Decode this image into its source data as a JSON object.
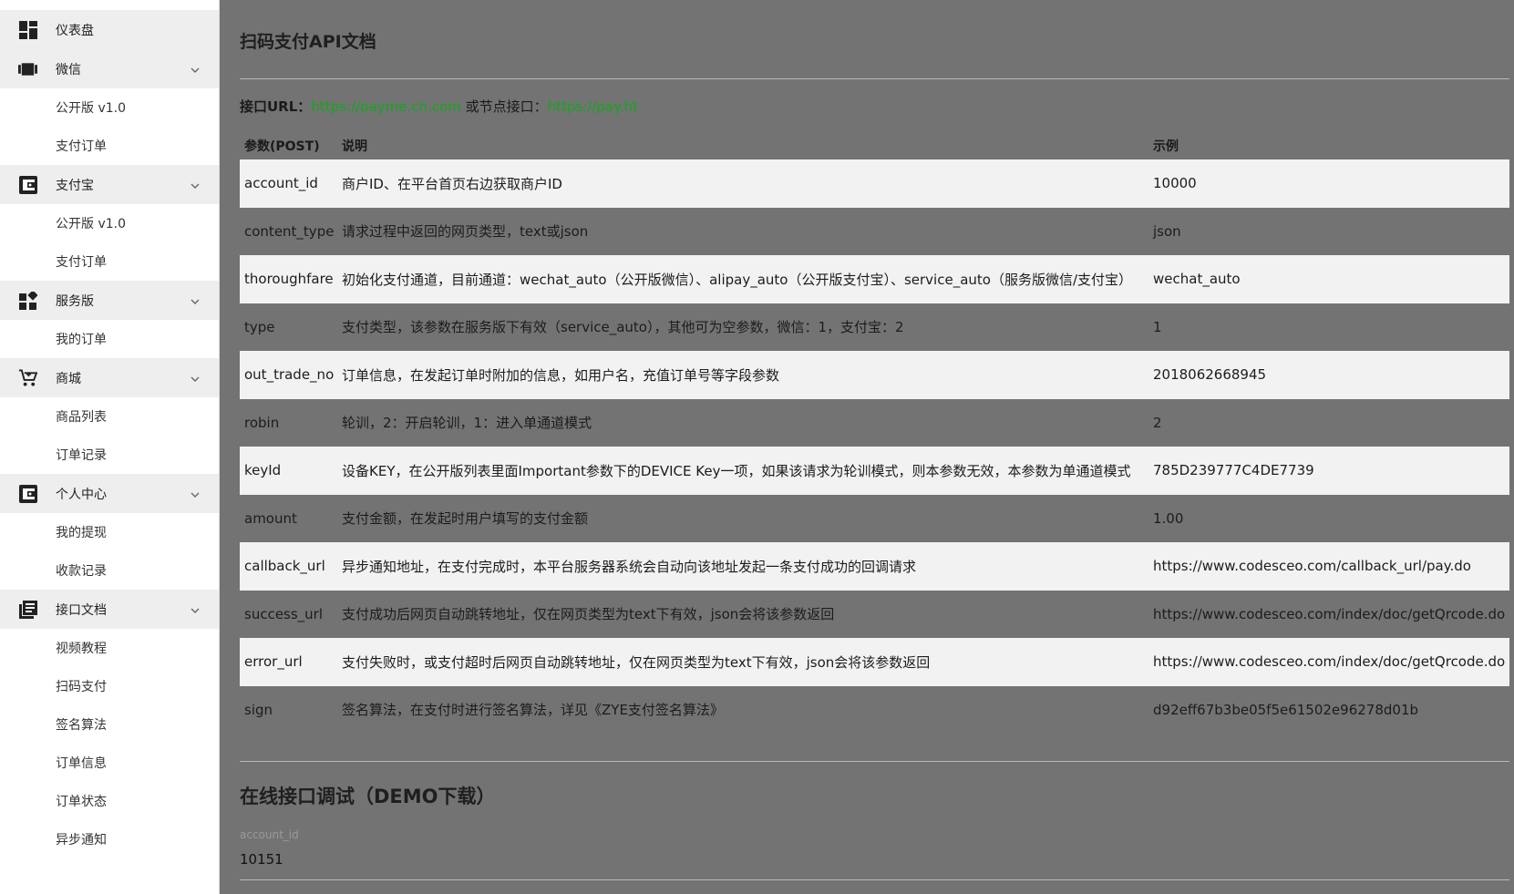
{
  "sidebar": {
    "items": [
      {
        "label": "仪表盘",
        "icon": "dashboard-icon",
        "expandable": false,
        "children": []
      },
      {
        "label": "微信",
        "icon": "wechat-icon",
        "expandable": true,
        "children": [
          "公开版 v1.0",
          "支付订单"
        ]
      },
      {
        "label": "支付宝",
        "icon": "wallet-icon",
        "expandable": true,
        "children": [
          "公开版 v1.0",
          "支付订单"
        ]
      },
      {
        "label": "服务版",
        "icon": "widgets-icon",
        "expandable": true,
        "children": [
          "我的订单"
        ]
      },
      {
        "label": "商城",
        "icon": "cart-icon",
        "expandable": true,
        "children": [
          "商品列表",
          "订单记录"
        ]
      },
      {
        "label": "个人中心",
        "icon": "wallet-icon",
        "expandable": true,
        "children": [
          "我的提现",
          "收款记录"
        ]
      },
      {
        "label": "接口文档",
        "icon": "docs-icon",
        "expandable": true,
        "children": [
          "视频教程",
          "扫码支付",
          "签名算法",
          "订单信息",
          "订单状态",
          "异步通知"
        ]
      }
    ]
  },
  "main": {
    "title": "扫码支付API文档",
    "api_url_label": "接口URL：",
    "api_url": "https://payme.cn.com",
    "node_label": " 或节点接口：",
    "node_url": "https://pay.ht",
    "table": {
      "headers": [
        "参数(POST)",
        "说明",
        "示例"
      ],
      "rows": [
        [
          "account_id",
          "商户ID、在平台首页右边获取商户ID",
          "10000"
        ],
        [
          "content_type",
          "请求过程中返回的网页类型，text或json",
          "json"
        ],
        [
          "thoroughfare",
          "初始化支付通道，目前通道：wechat_auto（公开版微信）、alipay_auto（公开版支付宝）、service_auto（服务版微信/支付宝）",
          "wechat_auto"
        ],
        [
          "type",
          "支付类型，该参数在服务版下有效（service_auto），其他可为空参数，微信：1，支付宝：2",
          "1"
        ],
        [
          "out_trade_no",
          "订单信息，在发起订单时附加的信息，如用户名，充值订单号等字段参数",
          "2018062668945"
        ],
        [
          "robin",
          "轮训，2：开启轮训，1：进入单通道模式",
          "2"
        ],
        [
          "keyId",
          "设备KEY，在公开版列表里面Important参数下的DEVICE Key一项，如果该请求为轮训模式，则本参数无效，本参数为单通道模式",
          "785D239777C4DE7739"
        ],
        [
          "amount",
          "支付金额，在发起时用户填写的支付金额",
          "1.00"
        ],
        [
          "callback_url",
          "异步通知地址，在支付完成时，本平台服务器系统会自动向该地址发起一条支付成功的回调请求",
          "https://www.codesceo.com/callback_url/pay.do"
        ],
        [
          "success_url",
          "支付成功后网页自动跳转地址，仅在网页类型为text下有效，json会将该参数返回",
          "https://www.codesceo.com/index/doc/getQrcode.do"
        ],
        [
          "error_url",
          "支付失败时，或支付超时后网页自动跳转地址，仅在网页类型为text下有效，json会将该参数返回",
          "https://www.codesceo.com/index/doc/getQrcode.do"
        ],
        [
          "sign",
          "签名算法，在支付时进行签名算法，详见《ZYE支付签名算法》",
          "d92eff67b3be05f5e61502e96278d01b"
        ]
      ]
    },
    "demo_title": "在线接口调试（DEMO下载）",
    "demo_field": {
      "label": "account_id",
      "value": "10151"
    }
  },
  "colors": {
    "background": "#737373",
    "sidebar_bg": "#ffffff",
    "sidebar_group_bg": "#eeeeee",
    "row_highlight": "#f2f2f2",
    "link_green": "#12a81a"
  }
}
